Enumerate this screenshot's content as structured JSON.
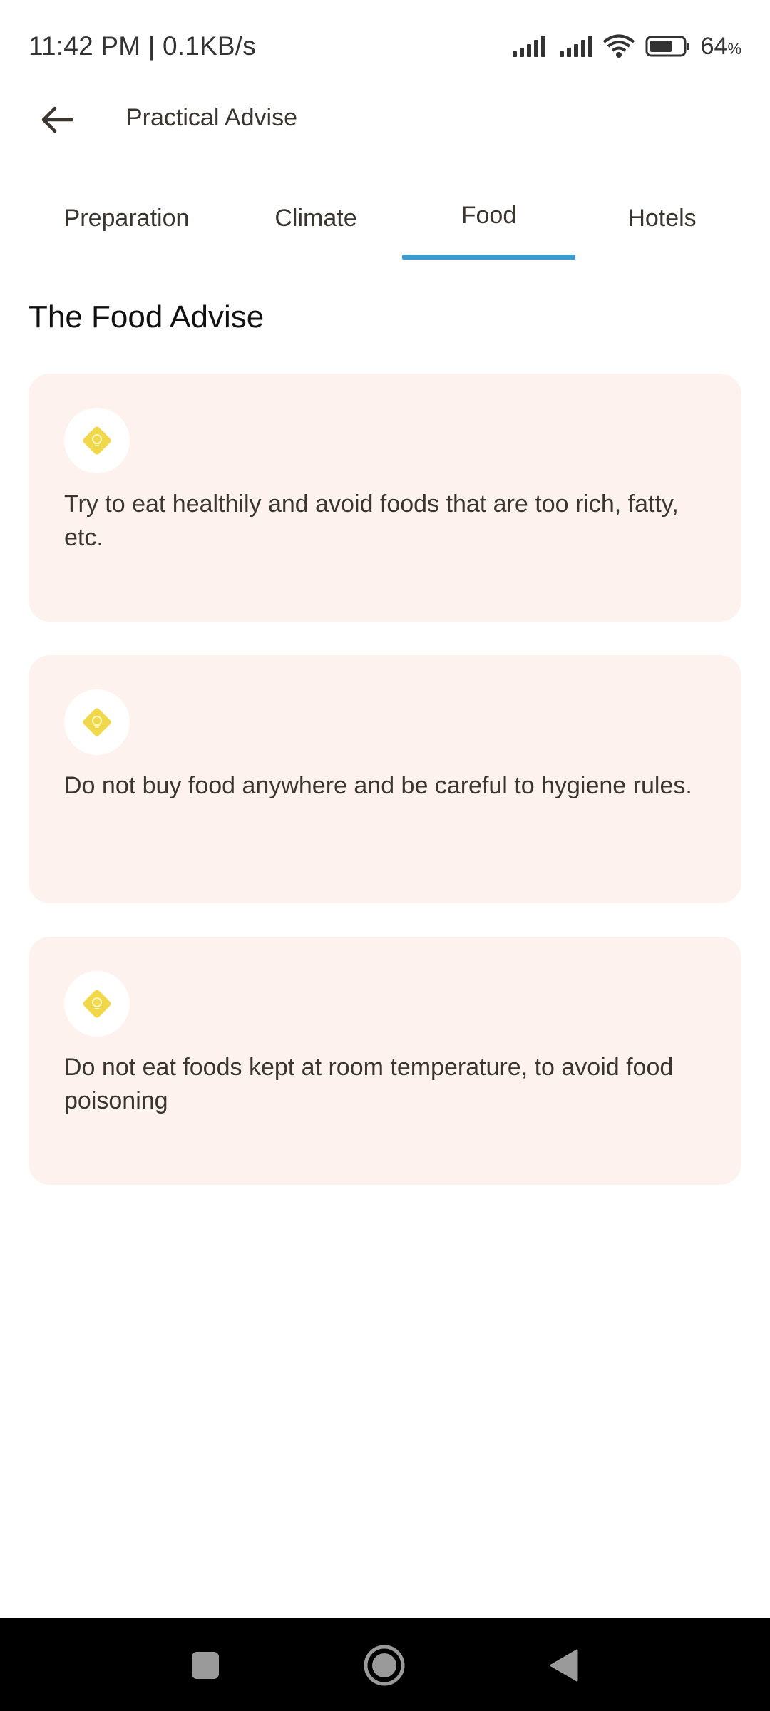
{
  "status_bar": {
    "time_speed": "11:42 PM | 0.1KB/s",
    "battery_level": "64",
    "battery_unit": "%"
  },
  "header": {
    "title": "Practical Advise"
  },
  "tabs": [
    {
      "label": "Preparation",
      "active": false
    },
    {
      "label": "Climate",
      "active": false
    },
    {
      "label": "Food",
      "active": true
    },
    {
      "label": "Hotels",
      "active": false
    }
  ],
  "section": {
    "title": "The Food Advise"
  },
  "cards": [
    {
      "icon": "lightbulb-icon",
      "text": "Try to eat healthily and avoid foods that are too rich, fatty, etc."
    },
    {
      "icon": "lightbulb-icon",
      "text": "Do not buy food anywhere and be careful to hygiene rules."
    },
    {
      "icon": "lightbulb-icon",
      "text": "Do not eat foods kept at room temperature, to avoid food poisoning"
    }
  ],
  "colors": {
    "accent": "#3a9bd2",
    "card_bg": "#fdf2ee",
    "icon_yellow": "#f0d84a"
  }
}
